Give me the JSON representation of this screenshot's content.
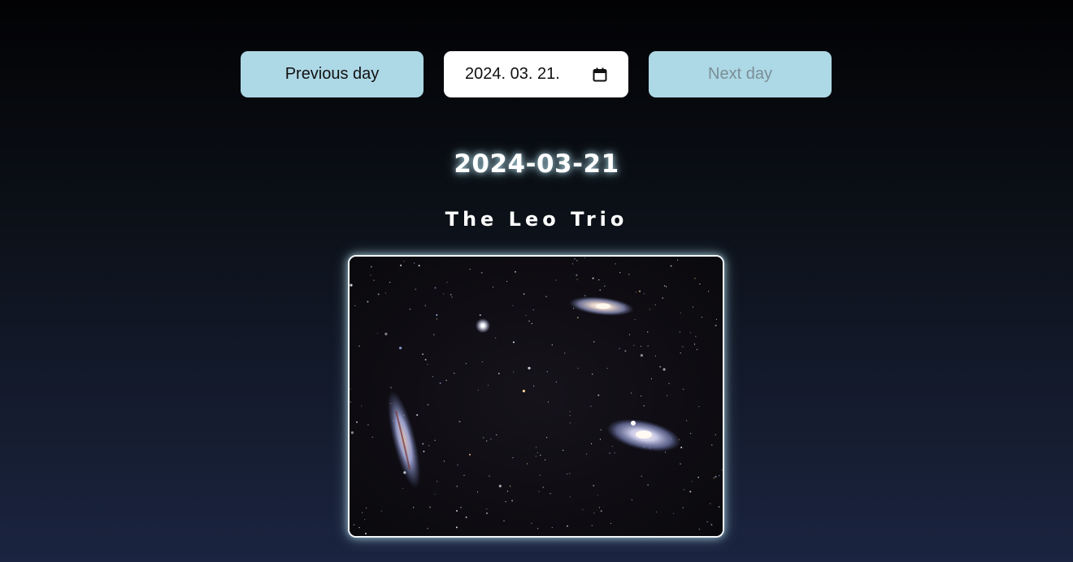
{
  "nav": {
    "prev_label": "Previous day",
    "next_label": "Next day",
    "next_disabled": true
  },
  "date_input": {
    "value": "2024. 03. 21.",
    "icon": "calendar-icon"
  },
  "apod": {
    "date": "2024-03-21",
    "title": "The Leo Trio",
    "image_subject": "Leo Trio galaxies"
  },
  "colors": {
    "button_bg": "#add8e6",
    "glow": "#add8e6",
    "background_top": "#020204",
    "background_bottom": "#1b2440"
  }
}
